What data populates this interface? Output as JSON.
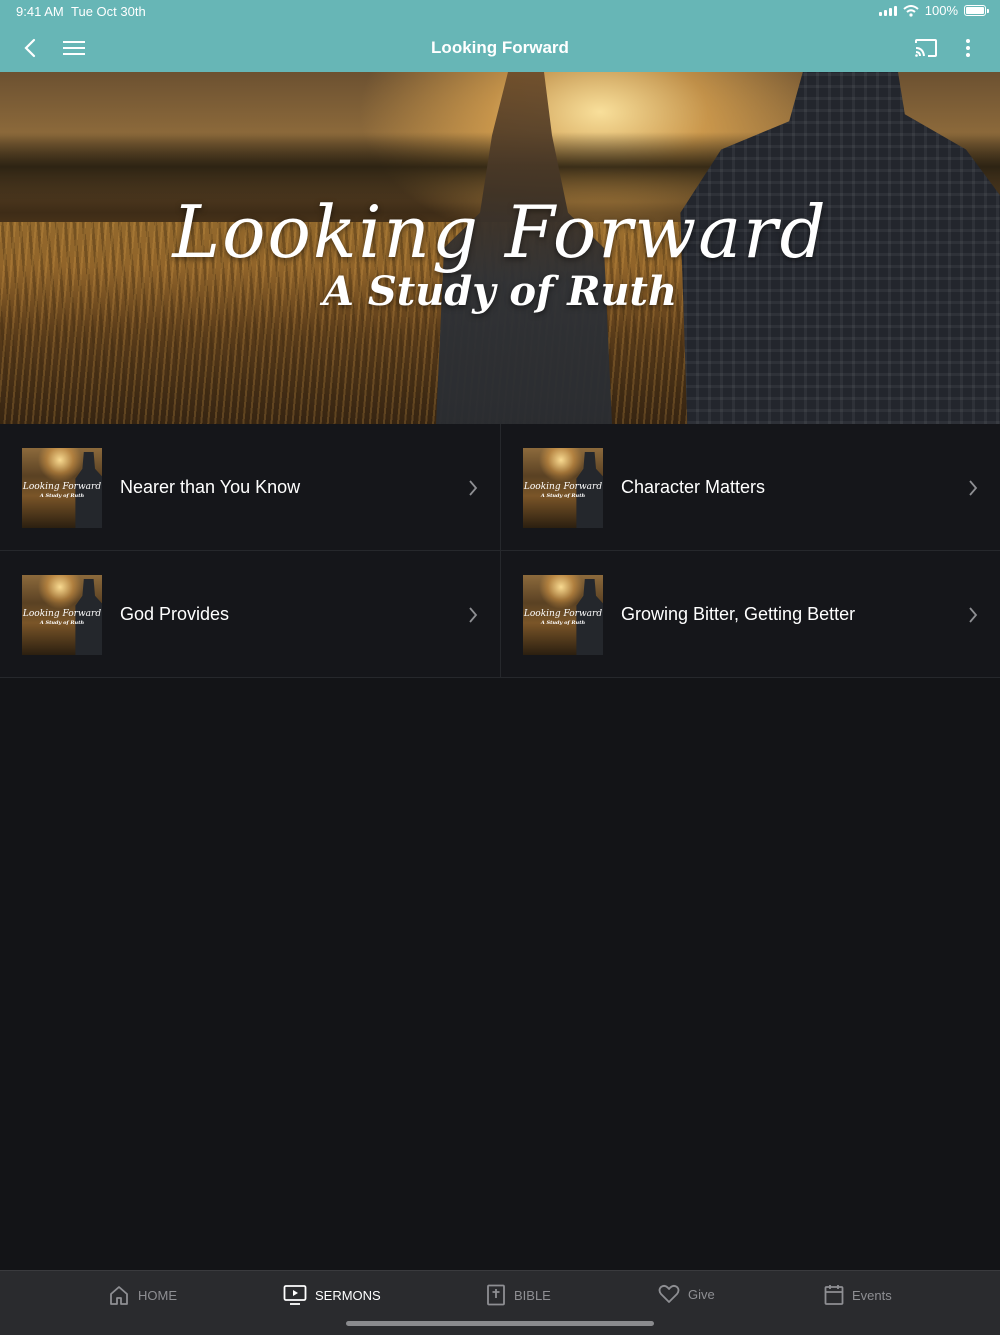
{
  "status": {
    "time": "9:41 AM",
    "date": "Tue Oct 30th",
    "battery": "100%"
  },
  "appbar": {
    "title": "Looking Forward"
  },
  "hero": {
    "title": "Looking Forward",
    "subtitle": "A Study of Ruth"
  },
  "thumb": {
    "title": "Looking Forward",
    "subtitle": "A Study of Ruth"
  },
  "sermons": [
    {
      "label": "Nearer than You Know"
    },
    {
      "label": "Character Matters"
    },
    {
      "label": "God Provides"
    },
    {
      "label": "Growing Bitter, Getting Better"
    }
  ],
  "tabs": [
    {
      "label": "HOME",
      "icon": "home-icon"
    },
    {
      "label": "SERMONS",
      "icon": "tv-icon"
    },
    {
      "label": "BIBLE",
      "icon": "bible-icon"
    },
    {
      "label": "Give",
      "icon": "heart-icon"
    },
    {
      "label": "Events",
      "icon": "calendar-icon"
    }
  ],
  "colors": {
    "accent": "#67b6b6",
    "background": "#131417",
    "tabbar": "#2a2b2e"
  }
}
